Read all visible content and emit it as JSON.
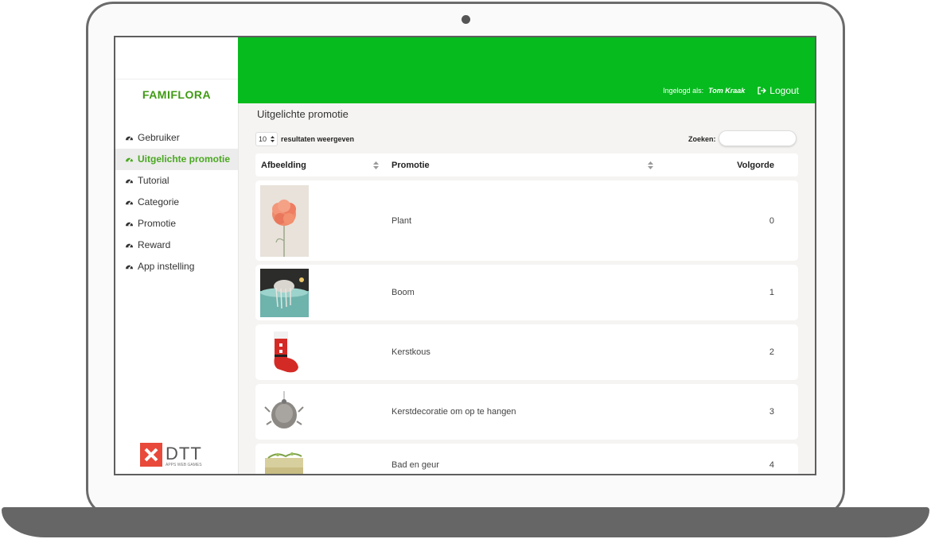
{
  "app": {
    "brand": "FAMIFLORA",
    "logo_text": "DTT",
    "logo_tagline": "APPS WEB GAMES"
  },
  "colors": {
    "header_green": "#06bb1e",
    "brand_green": "#3f9a13",
    "active_green": "#4aa722"
  },
  "sidebar": {
    "items": [
      {
        "label": "Gebruiker",
        "icon": "dashboard-icon",
        "active": false
      },
      {
        "label": "Uitgelichte promotie",
        "icon": "dashboard-icon",
        "active": true
      },
      {
        "label": "Tutorial",
        "icon": "dashboard-icon",
        "active": false
      },
      {
        "label": "Categorie",
        "icon": "dashboard-icon",
        "active": false
      },
      {
        "label": "Promotie",
        "icon": "dashboard-icon",
        "active": false
      },
      {
        "label": "Reward",
        "icon": "dashboard-icon",
        "active": false
      },
      {
        "label": "App instelling",
        "icon": "dashboard-icon",
        "active": false
      }
    ]
  },
  "header": {
    "logged_in_label": "Ingelogd als:",
    "user_name": "Tom Kraak",
    "logout_label": "Logout"
  },
  "main": {
    "title": "Uitgelichte promotie",
    "length_value": "10",
    "length_label": "resultaten weergeven",
    "search_label": "Zoeken:",
    "search_value": ""
  },
  "table": {
    "columns": [
      "Afbeelding",
      "Promotie",
      "Volgorde"
    ],
    "rows": [
      {
        "image": "carnation-flower",
        "name": "Plant",
        "order": "0"
      },
      {
        "image": "bath-scene",
        "name": "Boom",
        "order": "1"
      },
      {
        "image": "christmas-stocking",
        "name": "Kerstkous",
        "order": "2"
      },
      {
        "image": "furry-ornament",
        "name": "Kerstdecoratie om op te hangen",
        "order": "3"
      },
      {
        "image": "soap-bars",
        "name": "Bad en geur",
        "order": "4"
      }
    ]
  }
}
